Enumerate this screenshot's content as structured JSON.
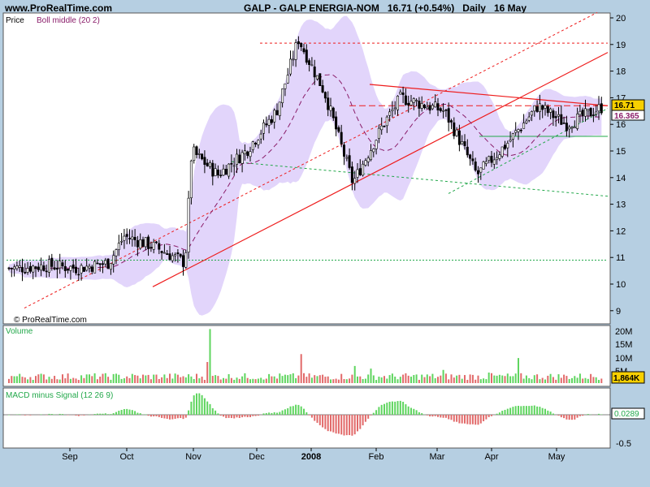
{
  "header": {
    "site": "www.ProRealTime.com",
    "ticker": "GALP - GALP ENERGIA-NOM",
    "price_change": "16.71 (+0.54%)",
    "period": "Daily",
    "date": "16 May"
  },
  "copyright": "© ProRealTime.com",
  "colors": {
    "background": "#b6cfe2",
    "panel": "#ffffff",
    "bollinger_fill": "#e2d5fb",
    "bollinger_mid": "#8a1d6a",
    "up_volume": "#5fd55f",
    "down_volume": "#e26a6a",
    "trend_red": "#ee1c1c",
    "trend_green": "#22a84a",
    "price_box": "#f7d000"
  },
  "chart_data": [
    {
      "type": "candlestick",
      "panel": "price",
      "title": "Price",
      "indicator_label": "Boll middle (20 2)",
      "ylim": [
        8.8,
        20.2
      ],
      "yticks": [
        "9",
        "10",
        "11",
        "12",
        "13",
        "14",
        "15",
        "16",
        "17",
        "18",
        "19",
        "20"
      ],
      "last_price": "16.71",
      "boll_middle_value": "16.365",
      "x_months": [
        "Sep",
        "Oct",
        "Nov",
        "Dec",
        "2008",
        "Feb",
        "Mar",
        "Apr",
        "May"
      ],
      "approx_closes": [
        [
          "2007-08-20",
          10.6
        ],
        [
          "2007-09-03",
          10.7
        ],
        [
          "2007-09-17",
          10.6
        ],
        [
          "2007-10-01",
          10.8
        ],
        [
          "2007-10-08",
          11.8
        ],
        [
          "2007-10-22",
          11.4
        ],
        [
          "2007-11-05",
          10.8
        ],
        [
          "2007-11-08",
          15.0
        ],
        [
          "2007-11-20",
          14.1
        ],
        [
          "2007-12-03",
          15.0
        ],
        [
          "2007-12-17",
          16.5
        ],
        [
          "2007-12-27",
          19.2
        ],
        [
          "2008-01-08",
          17.2
        ],
        [
          "2008-01-21",
          13.8
        ],
        [
          "2008-02-04",
          16.0
        ],
        [
          "2008-02-12",
          17.0
        ],
        [
          "2008-03-03",
          16.5
        ],
        [
          "2008-03-10",
          15.4
        ],
        [
          "2008-03-18",
          14.1
        ],
        [
          "2008-04-01",
          15.3
        ],
        [
          "2008-04-15",
          16.7
        ],
        [
          "2008-04-28",
          16.0
        ],
        [
          "2008-05-16",
          16.71
        ]
      ]
    },
    {
      "type": "bar",
      "panel": "volume",
      "title": "Volume",
      "yticks": [
        "20M",
        "15M",
        "10M",
        "5M"
      ],
      "last_value": "1,864K"
    },
    {
      "type": "bar",
      "panel": "macd",
      "title": "MACD minus Signal (12 26 9)",
      "yticks": [
        "0",
        "-0.5"
      ],
      "last_value": "0.0289"
    }
  ]
}
